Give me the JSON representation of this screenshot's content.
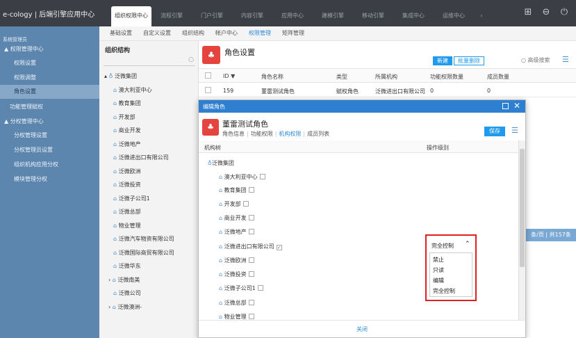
{
  "header": {
    "brand": "e-cology | 后端引擎应用中心",
    "tabs": [
      "组织权限中心",
      "流程引擎",
      "门户引擎",
      "内容引擎",
      "应用中心",
      "建模引擎",
      "移动引擎",
      "集成中心",
      "运维中心"
    ],
    "more": "›",
    "icons": [
      "grid-icon",
      "minus-circle-icon",
      "power-icon"
    ]
  },
  "subnav": [
    "基础设置",
    "自定义设置",
    "组织结构",
    "帐户中心",
    "权限管理",
    "矩阵管理"
  ],
  "sidebar": {
    "title": "系统管理员",
    "items": [
      {
        "label": "▲  权限管理中心"
      },
      {
        "label": "权限设置"
      },
      {
        "label": "权限调整"
      },
      {
        "label": "角色设置"
      },
      {
        "label": "功能管理赋权"
      },
      {
        "label": "▲  分权管理中心"
      },
      {
        "label": "分权管理设置"
      },
      {
        "label": "分权管理员设置"
      },
      {
        "label": "组织机构应用分权"
      },
      {
        "label": "模块管理分权"
      }
    ]
  },
  "tree": {
    "title": "组织结构",
    "root": "泛微集团",
    "nodes": [
      "澳大利亚中心",
      "教育集团",
      "开发部",
      "商业开发",
      "泛微地产",
      "泛微进出口有限公司",
      "泛微欧洲",
      "泛微投资",
      "泛微子公司1",
      "泛微总部",
      "物业管理",
      "泛微汽车物资有限公司",
      "泛微国际商贸有限公司",
      "泛微华东",
      "泛微南美",
      "泛微公司",
      "泛微澳洲-"
    ]
  },
  "main": {
    "title": "角色设置",
    "new_label": "新建",
    "batch_delete_label": "批量删除",
    "search_label": "高级搜索",
    "columns": [
      "ID ▼",
      "角色名称",
      "类型",
      "所属机构",
      "功能权限数量",
      "成员数量"
    ],
    "row": [
      "159",
      "董雷测试角色",
      "赋权角色",
      "泛微进出口有限公司",
      "0",
      "0"
    ],
    "pager": "条/页 | 共157条"
  },
  "modal": {
    "header": "编辑角色",
    "role_name": "董雷测试角色",
    "tabs": [
      "角色信息",
      "功能权限",
      "机构权限",
      "成员列表"
    ],
    "active_tab": "机构权限",
    "save_label": "保存",
    "col_tree": "机构树",
    "col_level": "操作级别",
    "root": "泛微集团",
    "rows": [
      {
        "label": "澳大利亚中心",
        "checked": ""
      },
      {
        "label": "教育集团",
        "checked": ""
      },
      {
        "label": "开发部",
        "checked": ""
      },
      {
        "label": "商业开发",
        "checked": ""
      },
      {
        "label": "泛微地产",
        "checked": ""
      },
      {
        "label": "泛微进出口有限公司",
        "checked": "✓"
      },
      {
        "label": "泛微欧洲",
        "checked": ""
      },
      {
        "label": "泛微投资",
        "checked": ""
      },
      {
        "label": "泛微子公司1",
        "checked": ""
      },
      {
        "label": "泛微总部",
        "checked": ""
      },
      {
        "label": "物业管理",
        "checked": ""
      }
    ],
    "close_label": "关闭",
    "dropdown": {
      "selected": "完全控制",
      "options": [
        "禁止",
        "只读",
        "编辑",
        "完全控制"
      ]
    }
  }
}
